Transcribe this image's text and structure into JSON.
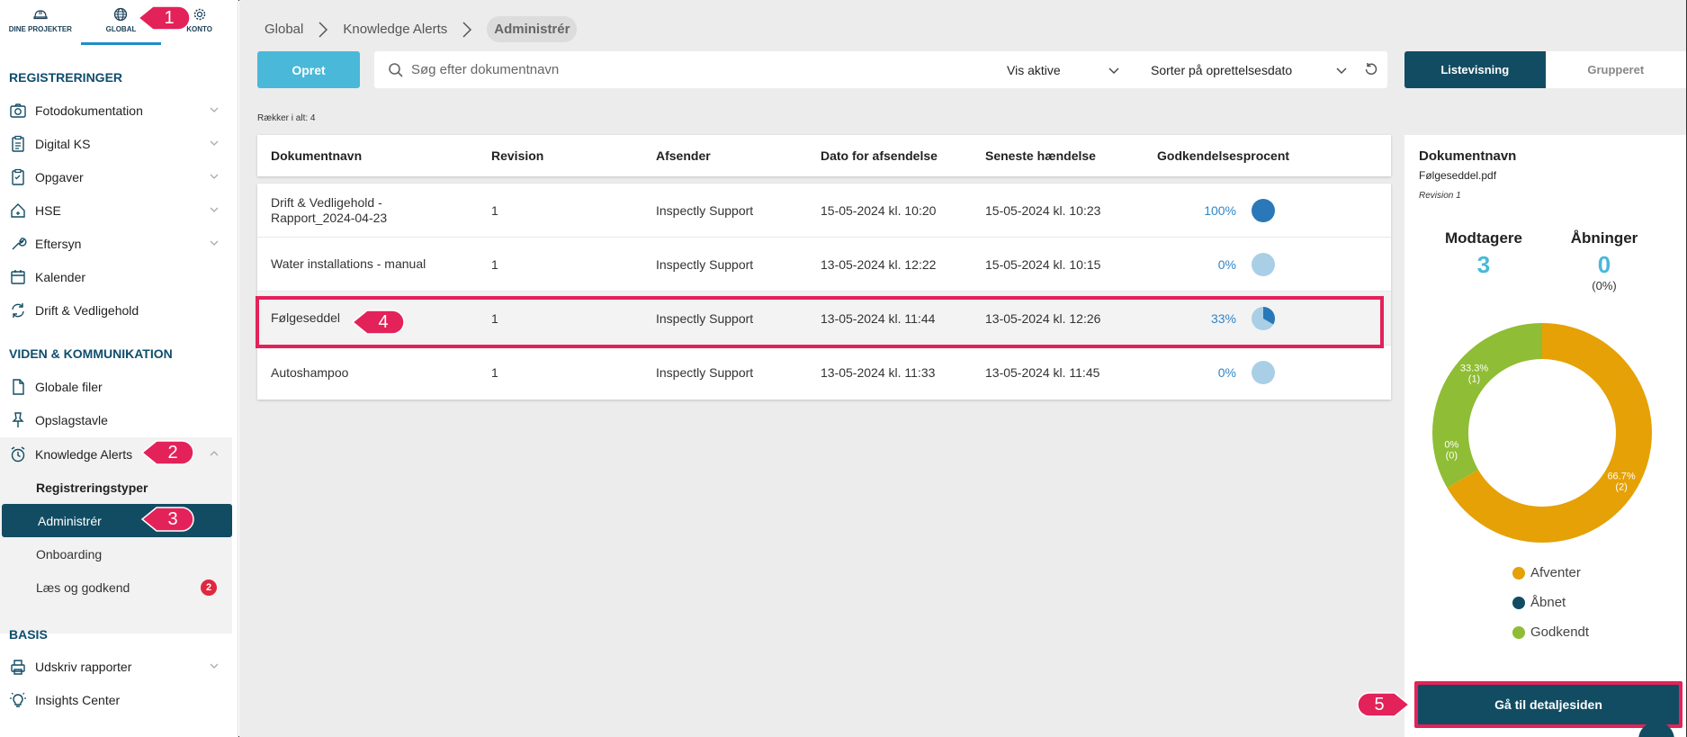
{
  "topnav": {
    "tabs": [
      {
        "label": "DINE PROJEKTER"
      },
      {
        "label": "GLOBAL"
      },
      {
        "label": "KONTO"
      }
    ]
  },
  "sidebar": {
    "section_registreringer": "REGISTRERINGER",
    "section_viden": "VIDEN & KOMMUNIKATION",
    "section_basis": "BASIS",
    "items": {
      "foto": "Fotodokumentation",
      "digital_ks": "Digital KS",
      "opgaver": "Opgaver",
      "hse": "HSE",
      "eftersyn": "Eftersyn",
      "kalender": "Kalender",
      "drift": "Drift & Vedligehold",
      "globale_filer": "Globale filer",
      "opslagstavle": "Opslagstavle",
      "knowledge_alerts": "Knowledge Alerts",
      "registreringstyper": "Registreringstyper",
      "administrer": "Administrér",
      "onboarding": "Onboarding",
      "laes": "Læs og godkend",
      "laes_badge": "2",
      "udskriv": "Udskriv rapporter",
      "insights": "Insights Center"
    }
  },
  "breadcrumb": {
    "global": "Global",
    "ka": "Knowledge Alerts",
    "current": "Administrér"
  },
  "toolbar": {
    "create_label": "Opret",
    "search_placeholder": "Søg efter dokumentnavn",
    "filter_active": "Vis aktive",
    "sort": "Sorter på oprettelsesdato",
    "view_list": "Listevisning",
    "view_group": "Grupperet"
  },
  "row_count": "Rækker i alt: 4",
  "table": {
    "headers": {
      "name": "Dokumentnavn",
      "revision": "Revision",
      "sender": "Afsender",
      "sent_date": "Dato for afsendelse",
      "last_event": "Seneste hændelse",
      "approval": "Godkendelsesprocent"
    },
    "rows": [
      {
        "name": "Drift & Vedligehold - Rapport_2024-04-23",
        "revision": "1",
        "sender": "Inspectly Support",
        "sent_date": "15-05-2024 kl. 10:20",
        "last_event": "15-05-2024 kl. 10:23",
        "approval": "100%",
        "approval_value": 1.0
      },
      {
        "name": "Water installations - manual",
        "revision": "1",
        "sender": "Inspectly Support",
        "sent_date": "13-05-2024 kl. 12:22",
        "last_event": "15-05-2024 kl. 10:15",
        "approval": "0%",
        "approval_value": 0.0
      },
      {
        "name": "Følgeseddel",
        "revision": "1",
        "sender": "Inspectly Support",
        "sent_date": "13-05-2024 kl. 11:44",
        "last_event": "13-05-2024 kl. 12:26",
        "approval": "33%",
        "approval_value": 0.333
      },
      {
        "name": "Autoshampoo",
        "revision": "1",
        "sender": "Inspectly Support",
        "sent_date": "13-05-2024 kl. 11:33",
        "last_event": "13-05-2024 kl. 11:45",
        "approval": "0%",
        "approval_value": 0.0
      }
    ]
  },
  "panel": {
    "title": "Dokumentnavn",
    "filename": "Følgeseddel.pdf",
    "revision": "Revision 1",
    "recipients_label": "Modtagere",
    "recipients_value": "3",
    "opens_label": "Åbninger",
    "opens_value": "0",
    "opens_pct": "(0%)",
    "donut": {
      "segments": [
        {
          "name": "Afventer",
          "value": 2,
          "pct_label": "66.7%",
          "count_label": "(2)",
          "color": "#e5a105"
        },
        {
          "name": "Åbnet",
          "value": 0,
          "pct_label": "0%",
          "count_label": "(0)",
          "color": "#124c63"
        },
        {
          "name": "Godkendt",
          "value": 1,
          "pct_label": "33.3%",
          "count_label": "(1)",
          "color": "#8fbd35"
        }
      ]
    },
    "legend": [
      "Afventer",
      "Åbnet",
      "Godkendt"
    ],
    "detail_button": "Gå til detaljesiden"
  },
  "colors": {
    "primary": "#124c63",
    "accent": "#4ab8d8",
    "highlight": "#e3225a",
    "pie_fill": "#2a78b8",
    "pie_empty": "#a9cfe6"
  },
  "annotations": [
    "1",
    "2",
    "3",
    "4",
    "5"
  ]
}
